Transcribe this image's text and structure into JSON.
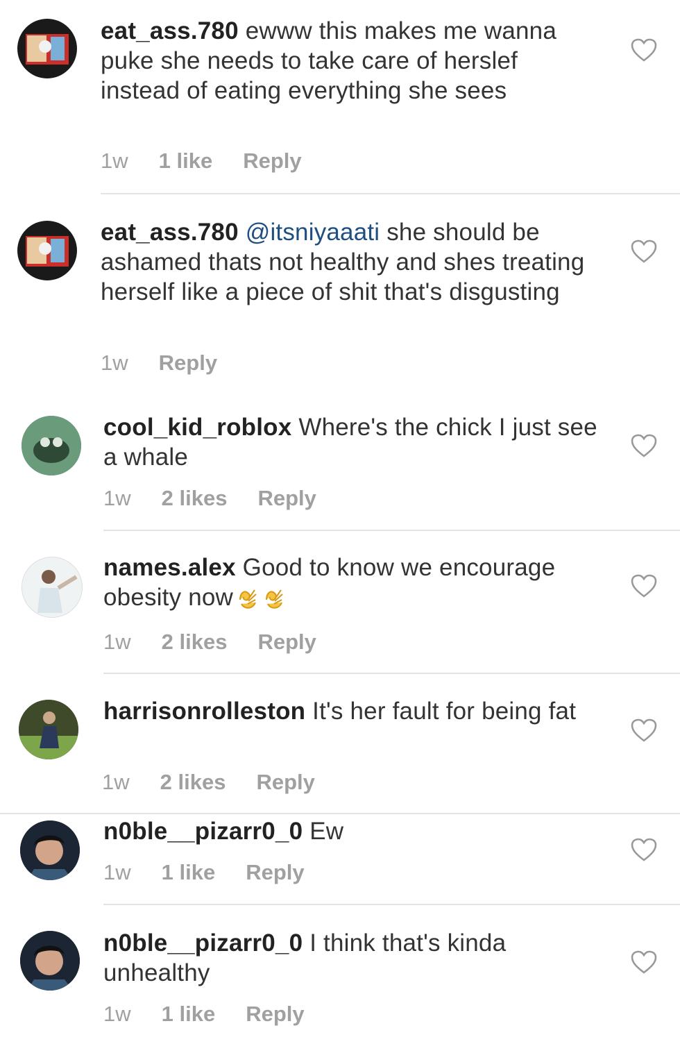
{
  "comments": [
    {
      "username": "eat_ass.780",
      "mention": "",
      "text": " ewww this makes me wanna puke she needs to take care of herslef instead of eating everything she sees",
      "time": "1w",
      "likes": "1 like",
      "reply": "Reply"
    },
    {
      "username": "eat_ass.780",
      "mention": "@itsniyaaati",
      "text": " she should be ashamed thats not healthy and shes treating herself like a piece of shit that's disgusting",
      "time": "1w",
      "likes": "",
      "reply": "Reply"
    },
    {
      "username": "cool_kid_roblox",
      "mention": "",
      "text": " Where's the chick I just see a whale",
      "time": "1w",
      "likes": "2 likes",
      "reply": "Reply"
    },
    {
      "username": "names.alex",
      "mention": "",
      "text": " Good to know we encourage obesity now",
      "time": "1w",
      "likes": "2 likes",
      "reply": "Reply"
    },
    {
      "username": "harrisonrolleston",
      "mention": "",
      "text": " It's her fault for being fat",
      "time": "1w",
      "likes": "2 likes",
      "reply": "Reply"
    },
    {
      "username": "n0ble__pizarr0_0",
      "mention": "",
      "text": " Ew",
      "time": "1w",
      "likes": "1 like",
      "reply": "Reply"
    },
    {
      "username": "n0ble__pizarr0_0",
      "mention": "",
      "text": " I think that's kinda unhealthy",
      "time": "1w",
      "likes": "1 like",
      "reply": "Reply"
    }
  ],
  "colors": {
    "username": "#222222",
    "mention": "#1f4f82",
    "meta": "#a0a0a0",
    "divider": "#e3e3e3"
  },
  "icons": [
    "heart-outline-icon",
    "ok-hand-emoji"
  ]
}
